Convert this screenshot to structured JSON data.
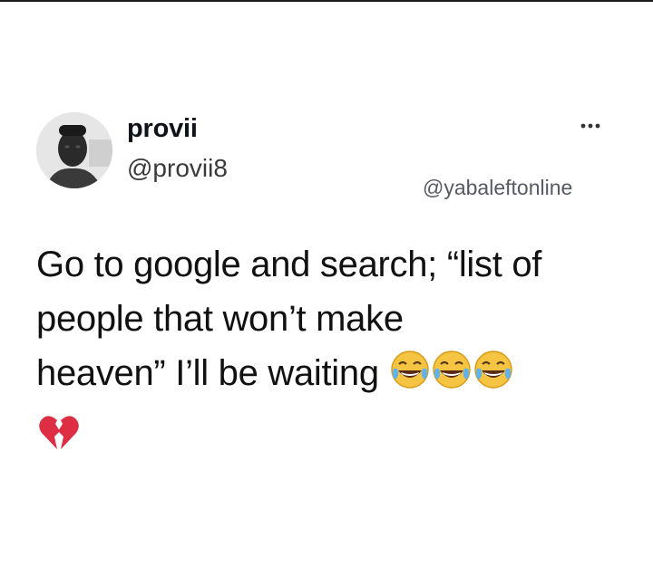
{
  "tweet": {
    "author": {
      "display_name": "provii",
      "handle": "@provii8"
    },
    "watermark": "@yabaleftonline",
    "text_lines": [
      "Go to google and search; “list of",
      "people that won’t make",
      "heaven”  I’ll be waiting"
    ],
    "emojis": [
      "face-with-tears-of-joy-icon",
      "face-with-tears-of-joy-icon",
      "face-with-tears-of-joy-icon",
      "broken-heart-icon"
    ]
  }
}
